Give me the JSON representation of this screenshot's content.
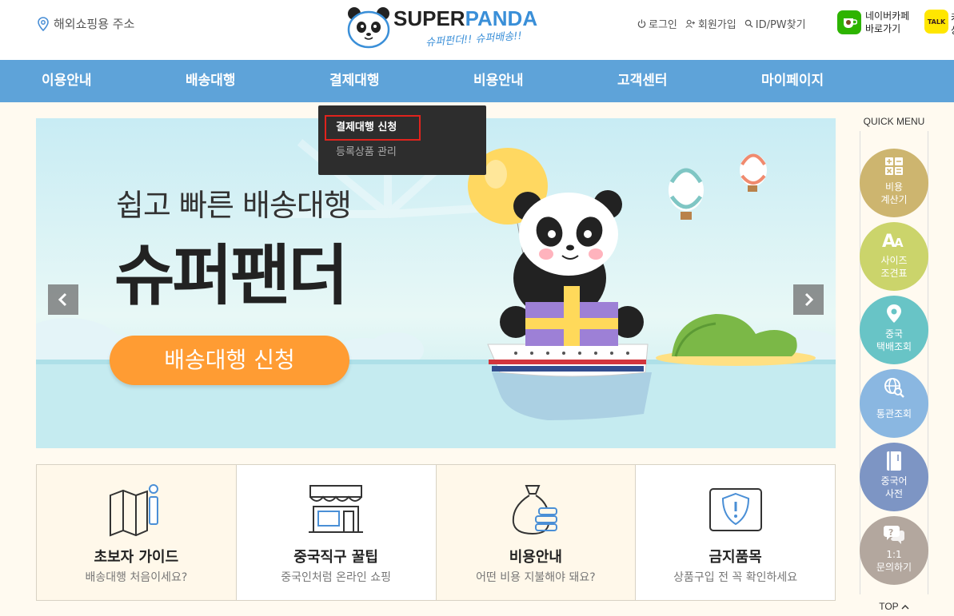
{
  "header": {
    "address_link": "해외쇼핑용 주소",
    "logo": {
      "brand_super": "SUPER",
      "brand_panda": "PANDA",
      "slogan": "슈퍼펀더!! 슈퍼배송!!"
    },
    "links": {
      "login": "로그인",
      "signup": "회원가입",
      "find": "ID/PW찾기"
    },
    "naver_cafe": {
      "line1": "네이버카페",
      "line2": "바로가기"
    },
    "kakao": {
      "badge": "TALK",
      "cut_line1": "카",
      "cut_line2": "상"
    }
  },
  "nav": {
    "items": [
      "이용안내",
      "배송대행",
      "결제대행",
      "비용안내",
      "고객센터",
      "마이페이지"
    ]
  },
  "dropdown": {
    "items": [
      "결제대행 신청",
      "등록상품 관리"
    ]
  },
  "banner": {
    "subtitle": "쉽고 빠른 배송대행",
    "title": "슈퍼팬더",
    "cta": "배송대행 신청"
  },
  "features": [
    {
      "title": "초보자 가이드",
      "desc": "배송대행 처음이세요?",
      "icon": "map-info-icon"
    },
    {
      "title": "중국직구 꿀팁",
      "desc": "중국인처럼 온라인 쇼핑",
      "icon": "storefront-icon"
    },
    {
      "title": "비용안내",
      "desc": "어떤 비용 지불해야 돼요?",
      "icon": "money-bag-icon"
    },
    {
      "title": "금지품목",
      "desc": "상품구입 전 꼭 확인하세요",
      "icon": "shield-icon"
    }
  ],
  "quick_menu": {
    "title": "QUICK MENU",
    "items": [
      {
        "label": "비용\n계산기",
        "icon": "calculator-icon",
        "color": "#cdb56f"
      },
      {
        "label": "사이즈\n조견표",
        "icon": "font-size-icon",
        "color": "#cbd46b"
      },
      {
        "label": "중국\n택배조회",
        "icon": "location-pin-icon",
        "color": "#68c4c6"
      },
      {
        "label": "통관조회",
        "icon": "globe-search-icon",
        "color": "#8ab7e1"
      },
      {
        "label": "중국어\n사전",
        "icon": "book-icon",
        "color": "#7d95c4"
      },
      {
        "label": "1:1\n문의하기",
        "icon": "question-chat-icon",
        "color": "#b3a79e"
      }
    ],
    "top": "TOP"
  },
  "colors": {
    "nav_bg": "#5ea3d9",
    "cta_orange": "#ff9c33",
    "page_bg": "#fffaf0",
    "dropdown_bg": "#2d2d2d",
    "highlight_red": "#e0231d"
  }
}
